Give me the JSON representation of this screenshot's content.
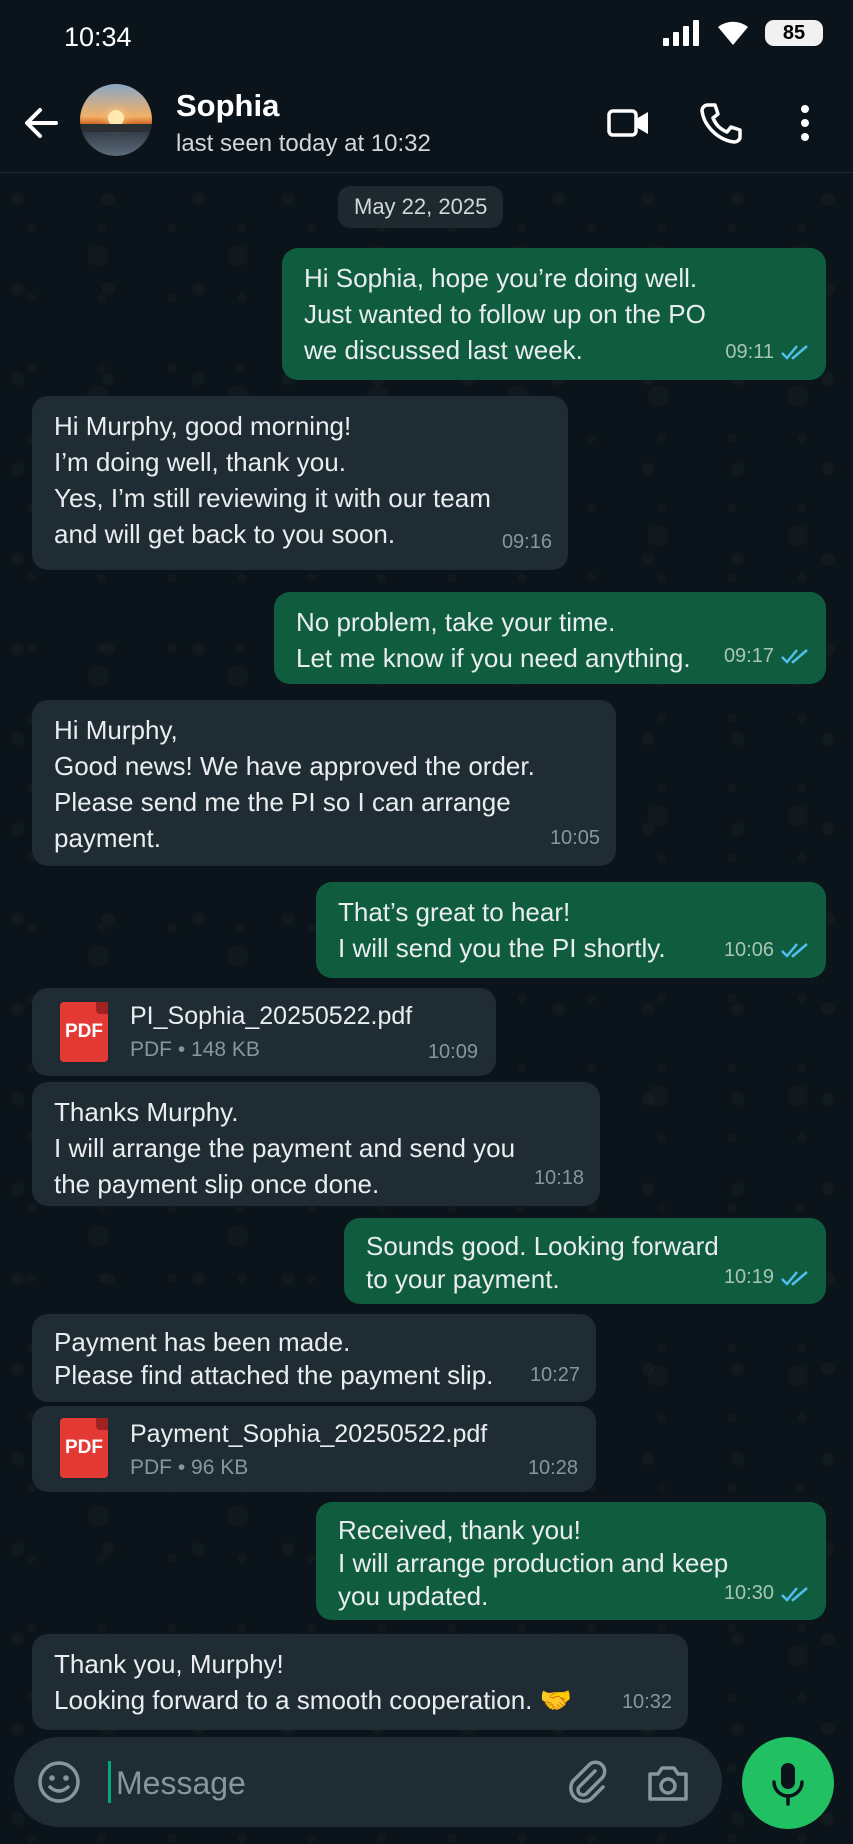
{
  "status_bar": {
    "time": "10:34",
    "battery": "85"
  },
  "header": {
    "name": "Sophia",
    "status": "last seen today at 10:32"
  },
  "date_chip": "May 22, 2025",
  "messages": [
    {
      "lines": [
        "Hi Sophia, hope you’re doing well.",
        "Just wanted to follow up on the PO",
        "we discussed last week."
      ],
      "time": "09:11"
    },
    {
      "lines": [
        "Hi Murphy, good morning!",
        "I’m doing well, thank you.",
        "Yes, I’m still reviewing it with our team",
        "and will get back to you soon."
      ],
      "time": "09:16"
    },
    {
      "lines": [
        "No problem, take your time.",
        "Let me know if you need anything."
      ],
      "time": "09:17"
    },
    {
      "lines": [
        "Hi Murphy,",
        "Good news! We have approved the order.",
        "Please send me the PI so I can arrange",
        "payment."
      ],
      "time": "10:05"
    },
    {
      "lines": [
        "That’s great to hear!",
        "I will send you the PI shortly."
      ],
      "time": "10:06"
    },
    {
      "file": "PI_Sophia_20250522.pdf",
      "info": "PDF • 148 KB",
      "time": "10:09",
      "icon": "PDF"
    },
    {
      "lines": [
        "Thanks Murphy.",
        "I will arrange the payment and send you",
        "the payment slip once done."
      ],
      "time": "10:18"
    },
    {
      "lines": [
        "Sounds good. Looking forward",
        "to your payment."
      ],
      "time": "10:19"
    },
    {
      "lines": [
        "Payment has been made.",
        "Please find attached the payment slip."
      ],
      "time": "10:27"
    },
    {
      "file": "Payment_Sophia_20250522.pdf",
      "info": "PDF • 96 KB",
      "time": "10:28",
      "icon": "PDF"
    },
    {
      "lines": [
        "Received, thank you!",
        "I will arrange production and keep",
        "you updated."
      ],
      "time": "10:30"
    },
    {
      "lines": [
        "Thank you, Murphy!",
        "Looking forward to a smooth cooperation. 🤝"
      ],
      "time": "10:32"
    }
  ],
  "composer": {
    "placeholder": "Message"
  },
  "colors": {
    "outgoing_bubble": "#0f5d3e",
    "incoming_bubble": "#202c33",
    "accent": "#21c063",
    "read_ticks": "#53bdeb"
  }
}
